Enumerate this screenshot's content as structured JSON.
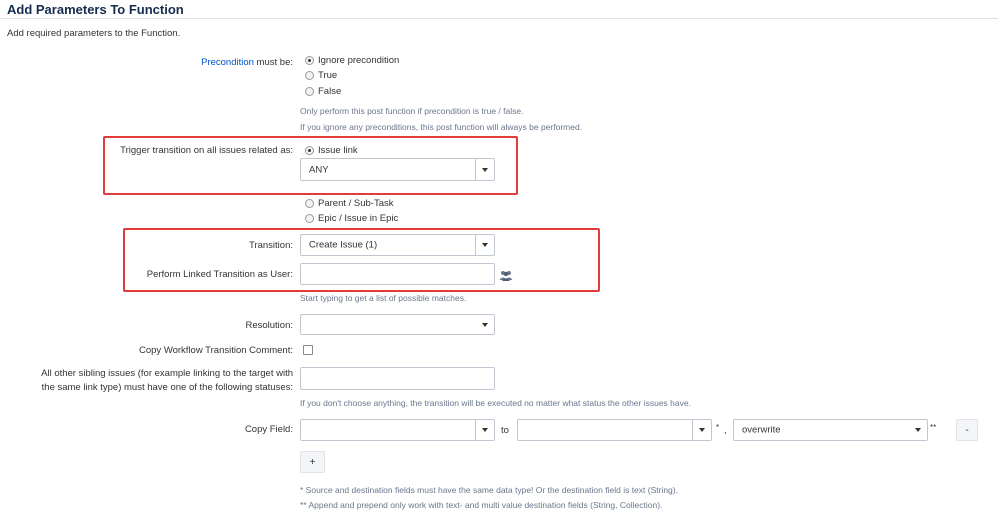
{
  "header": {
    "title": "Add Parameters To Function",
    "description": "Add required parameters to the Function."
  },
  "precondition": {
    "label_link": "Precondition",
    "label_rest": " must be:",
    "options": [
      "Ignore precondition",
      "True",
      "False"
    ],
    "selected": 0,
    "help1": "Only perform this post function if precondition is true / false.",
    "help2": "If you ignore any preconditions, this post function will always be performed."
  },
  "trigger": {
    "label": "Trigger transition on all issues related as:",
    "options": [
      "Issue link",
      "Parent / Sub-Task",
      "Epic / Issue in Epic"
    ],
    "selected": 0,
    "link_type_value": "ANY"
  },
  "transition": {
    "label": "Transition:",
    "value": "Create Issue (1)"
  },
  "linked_user": {
    "label": "Perform Linked Transition as User:",
    "value": "",
    "icon": "users-icon",
    "help": "Start typing to get a list of possible matches."
  },
  "resolution": {
    "label": "Resolution:",
    "value": ""
  },
  "copy_comment": {
    "label": "Copy Workflow Transition Comment:",
    "checked": false
  },
  "sibling": {
    "label_line1": "All other sibling issues (for example linking to the target with",
    "label_line2": "the same link type) must have one of the following statuses:",
    "value": "",
    "help": "If you don't choose anything, the transition will be executed no matter what status the other issues have."
  },
  "copy_field": {
    "label": "Copy Field:",
    "source_value": "",
    "to_text": "to",
    "target_value": "",
    "star": "*",
    "comma": ",",
    "mode_value": "overwrite",
    "double_star": "**",
    "remove_label": "-",
    "add_label": "+",
    "note1": "* Source and destination fields must have the same data type! Or the destination field is text (String).",
    "note2": "** Append and prepend only work with text- and multi value destination fields (String, Collection)."
  },
  "highlight_color": "#e03c3c",
  "link_color": "#0052cc"
}
